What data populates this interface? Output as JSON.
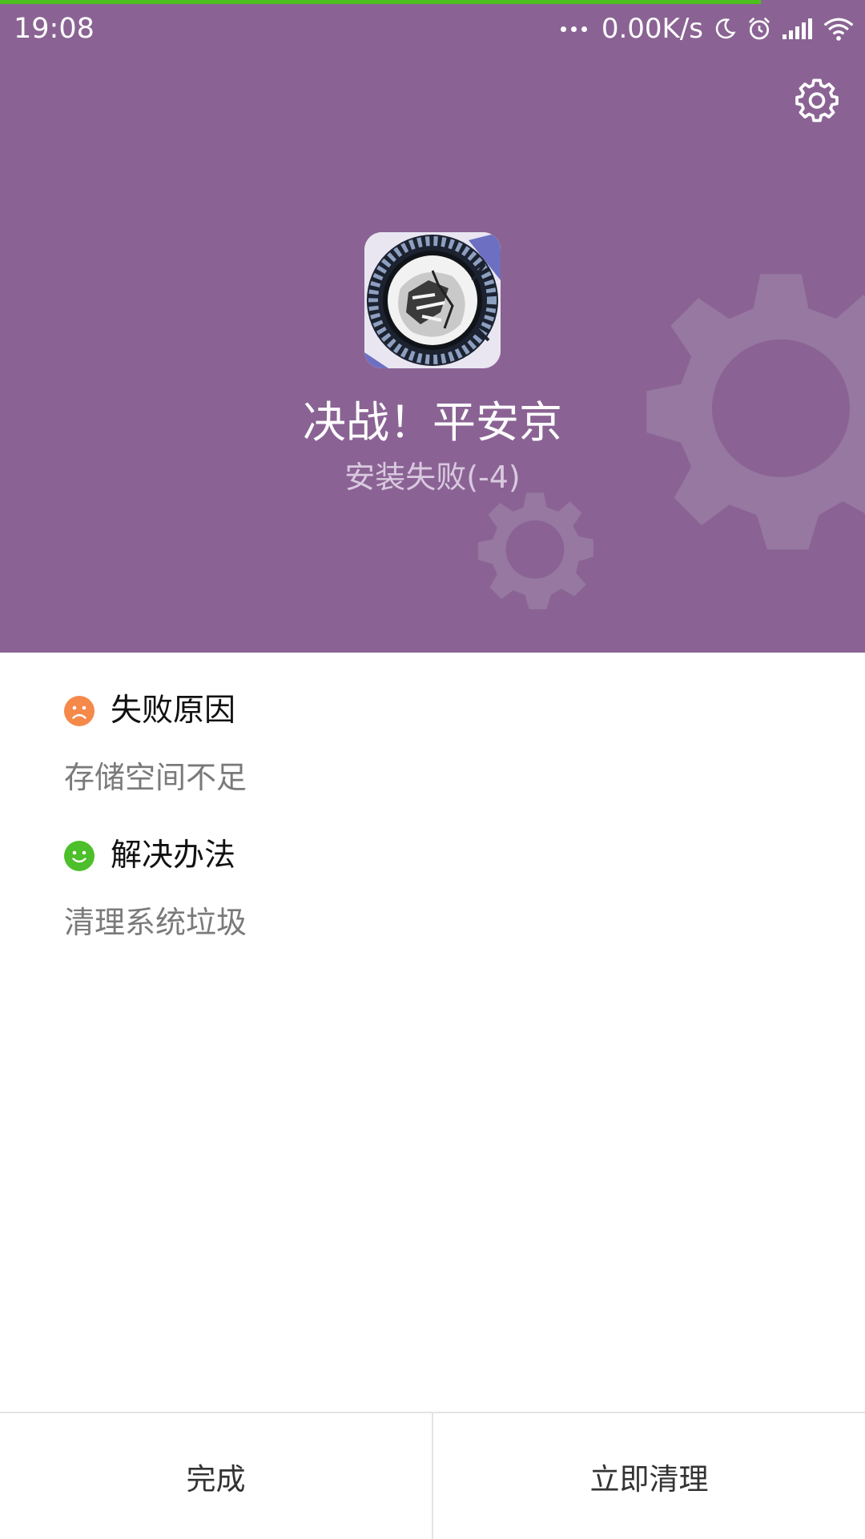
{
  "status_bar": {
    "time": "19:08",
    "network_speed": "0.00K/s",
    "icons": [
      "more-dots-icon",
      "moon-icon",
      "alarm-icon",
      "signal-icon",
      "wifi-icon"
    ]
  },
  "header": {
    "background_color": "#8a6394",
    "progress_color": "#4cbf1c",
    "settings_icon": "gear-icon",
    "app_name": "决战！平安京",
    "install_status": "安装失败(-4)"
  },
  "failure": {
    "title": "失败原因",
    "icon": "sad-face-icon",
    "icon_color": "#f5894a",
    "detail": "存储空间不足"
  },
  "solution": {
    "title": "解决办法",
    "icon": "smile-face-icon",
    "icon_color": "#4cbf2a",
    "detail": "清理系统垃圾"
  },
  "actions": {
    "done_label": "完成",
    "clean_label": "立即清理"
  }
}
